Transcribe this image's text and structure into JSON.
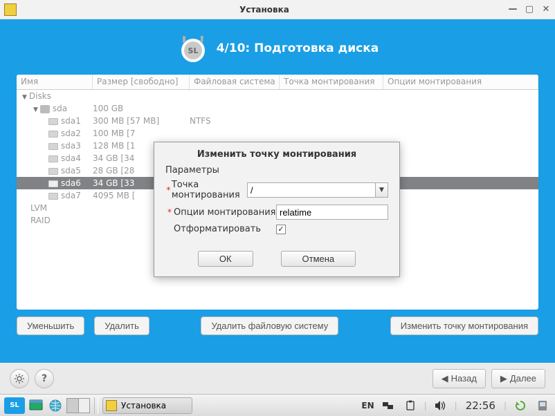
{
  "window": {
    "title": "Установка"
  },
  "step": {
    "title": "4/10: Подготовка диска"
  },
  "columns": {
    "name": "Имя",
    "size": "Размер [свободно]",
    "fs": "Файловая система",
    "mount": "Точка монтирования",
    "opts": "Опции монтирования"
  },
  "tree": {
    "root_label": "Disks",
    "disk_label": "sda",
    "disk_size": "100 GB",
    "partitions": [
      {
        "name": "sda1",
        "size": "300 MB [57 MB]",
        "fs": "NTFS"
      },
      {
        "name": "sda2",
        "size": "100 MB [7",
        "fs": ""
      },
      {
        "name": "sda3",
        "size": "128 MB [1",
        "fs": ""
      },
      {
        "name": "sda4",
        "size": "34 GB [34",
        "fs": ""
      },
      {
        "name": "sda5",
        "size": "28 GB [28",
        "fs": ""
      },
      {
        "name": "sda6",
        "size": "34 GB [33",
        "fs": ""
      },
      {
        "name": "sda7",
        "size": "4095 MB [",
        "fs": ""
      }
    ],
    "lvm": "LVM",
    "raid": "RAID"
  },
  "actions": {
    "shrink": "Уменьшить",
    "delete": "Удалить",
    "delete_fs": "Удалить файловую систему",
    "change_mount": "Изменить точку монтирования"
  },
  "nav": {
    "back": "Назад",
    "next": "Далее"
  },
  "dialog": {
    "title": "Изменить точку монтирования",
    "params_label": "Параметры",
    "mount_label": "Точка монтирования",
    "mount_value": "/",
    "opts_label": "Опции монтирования",
    "opts_value": "relatime",
    "format_label": "Отформатировать",
    "format_checked": "✓",
    "ok": "ОК",
    "cancel": "Отмена"
  },
  "taskbar": {
    "launcher": "SL",
    "task_title": "Установка",
    "lang": "EN",
    "clock": "22:56"
  }
}
